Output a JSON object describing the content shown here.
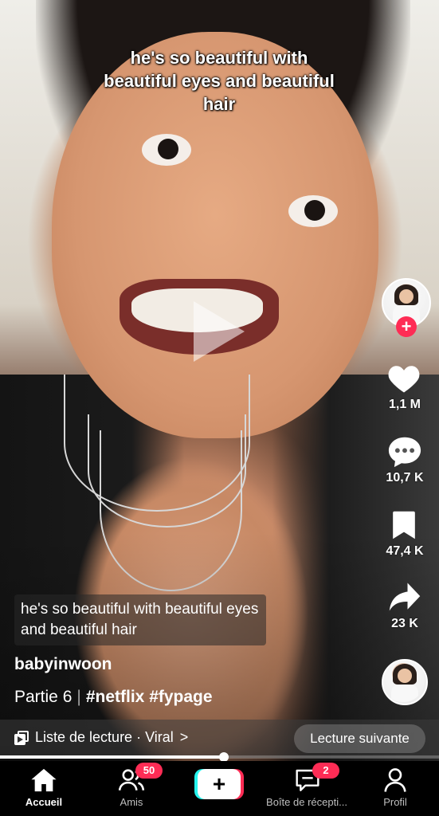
{
  "video": {
    "overlay_caption": "he's so beautiful with beautiful eyes and beautiful hair",
    "subtitle": "he's so beautiful with beautiful eyes and beautiful hair"
  },
  "actions": {
    "likes": "1,1 M",
    "comments": "10,7 K",
    "saves": "47,4 K",
    "shares": "23 K"
  },
  "post": {
    "username": "babyinwoon",
    "part": "Partie 6",
    "separator": "|",
    "hashtags": "#netflix #fypage"
  },
  "playlist": {
    "label": "Liste de lecture · Viral",
    "chevron": ">",
    "next_label": "Lecture suivante"
  },
  "progress": {
    "fraction": 0.51
  },
  "tabbar": {
    "home": "Accueil",
    "friends": "Amis",
    "friends_badge": "50",
    "create": "+",
    "inbox": "Boîte de récepti...",
    "inbox_badge": "2",
    "profile": "Profil"
  },
  "colors": {
    "accent": "#fe2c55",
    "cyan": "#25f4ee"
  },
  "icons": [
    "heart-icon",
    "comment-icon",
    "bookmark-icon",
    "share-icon",
    "home-icon",
    "friends-icon",
    "inbox-icon",
    "profile-icon",
    "playlist-icon",
    "play-icon",
    "plus-icon"
  ]
}
